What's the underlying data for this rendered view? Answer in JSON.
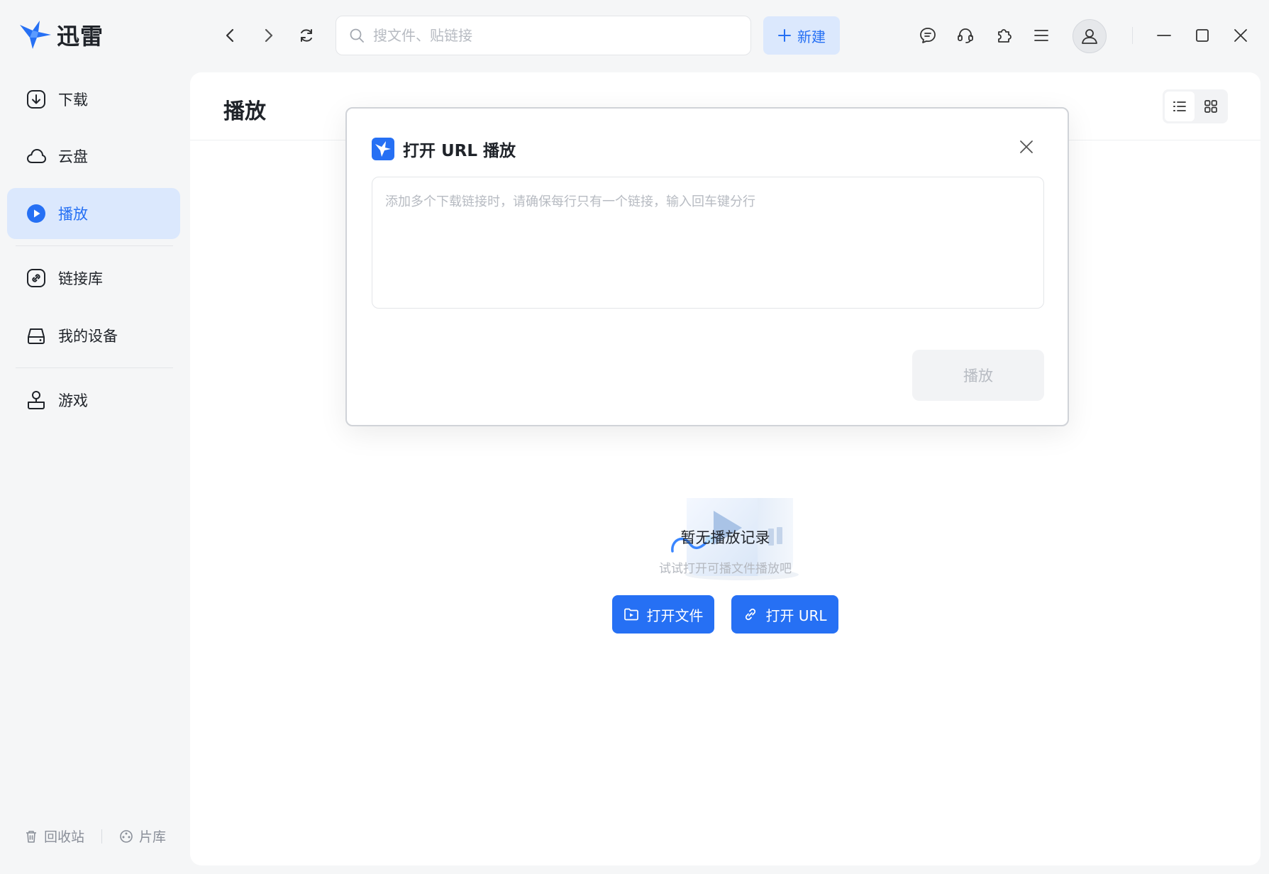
{
  "app": {
    "name": "迅雷"
  },
  "search": {
    "placeholder": "搜文件、贴链接"
  },
  "toolbar": {
    "new_label": "新建"
  },
  "sidebar": {
    "items": [
      {
        "label": "下载"
      },
      {
        "label": "云盘"
      },
      {
        "label": "播放"
      },
      {
        "label": "链接库"
      },
      {
        "label": "我的设备"
      },
      {
        "label": "游戏"
      }
    ],
    "footer": {
      "recycle_label": "回收站",
      "library_label": "片库"
    }
  },
  "main": {
    "title": "播放",
    "empty": {
      "title": "暂无播放记录",
      "subtitle": "试试打开可播文件播放吧",
      "open_file_label": "打开文件",
      "open_url_label": "打开 URL"
    }
  },
  "modal": {
    "title": "打开 URL 播放",
    "textarea_placeholder": "添加多个下载链接时，请确保每行只有一个链接，输入回车键分行",
    "play_label": "播放"
  },
  "colors": {
    "accent": "#2670f4",
    "accent_light": "#dbe8fd",
    "background": "#f5f6f7",
    "disabled_text": "#b7bbc2"
  }
}
